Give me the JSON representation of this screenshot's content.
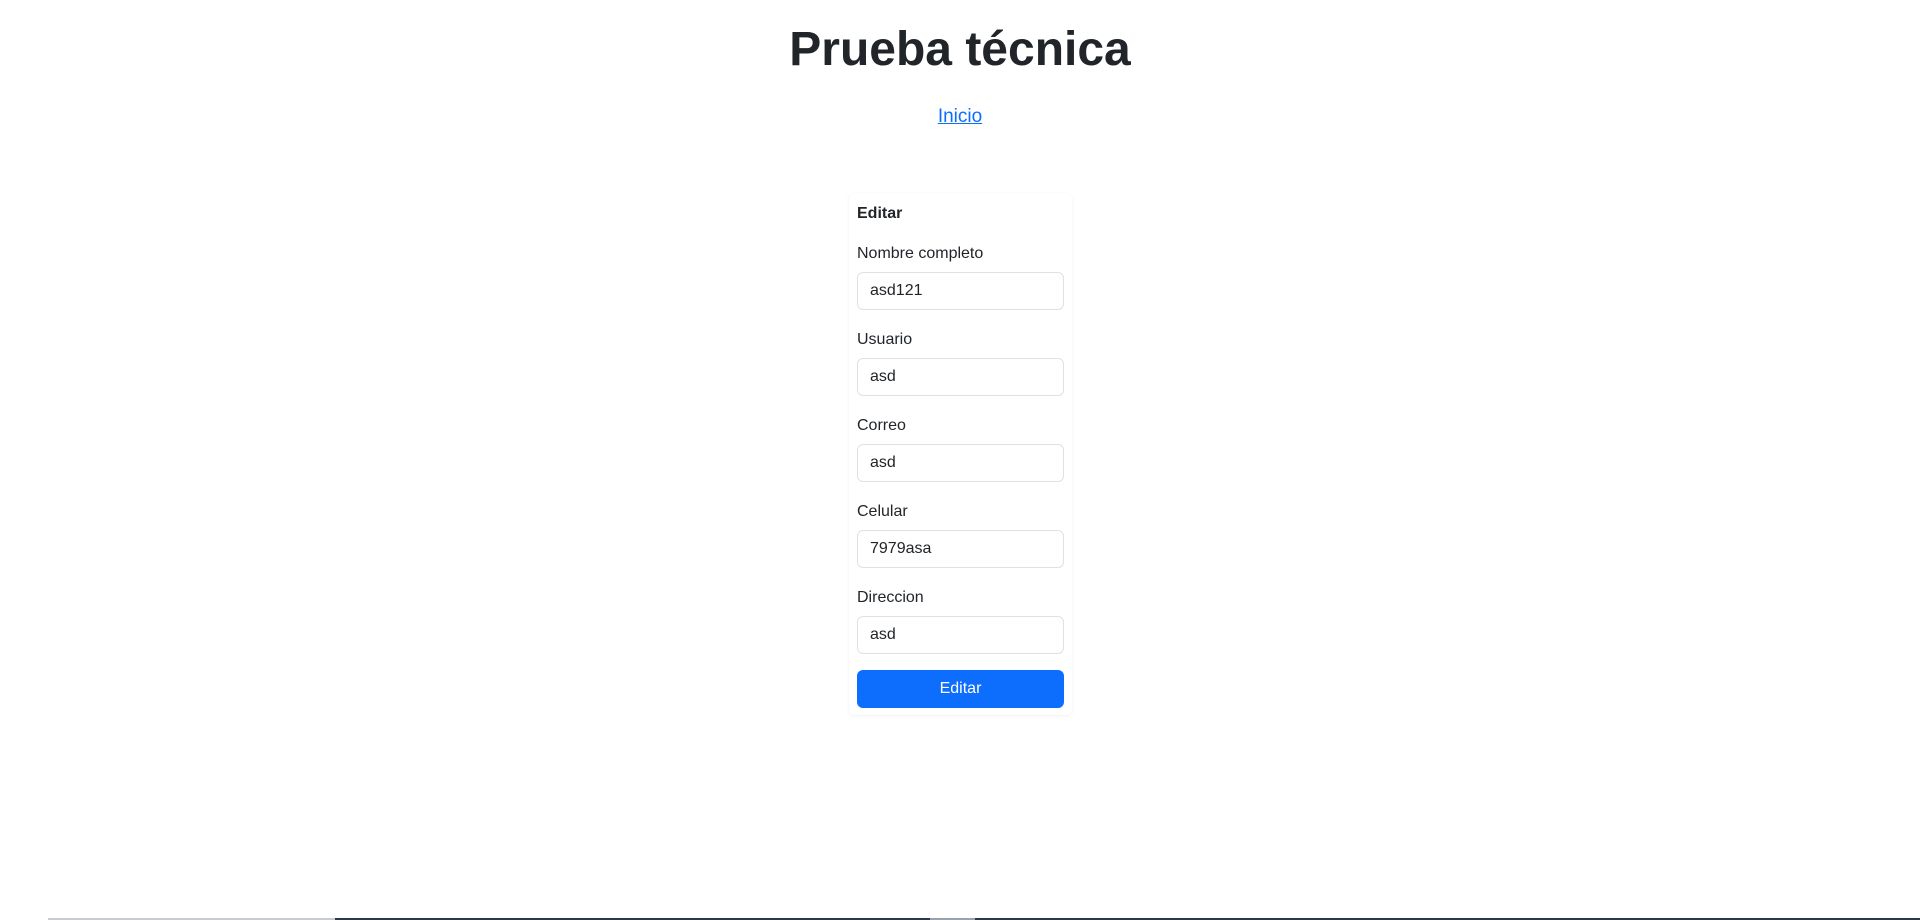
{
  "header": {
    "title": "Prueba técnica",
    "home_link": "Inicio"
  },
  "form": {
    "title": "Editar",
    "fields": [
      {
        "label": "Nombre completo",
        "value": "asd121"
      },
      {
        "label": "Usuario",
        "value": "asd"
      },
      {
        "label": "Correo",
        "value": "asd"
      },
      {
        "label": "Celular",
        "value": "7979asa"
      },
      {
        "label": "Direccion",
        "value": "asd"
      }
    ],
    "submit_label": "Editar"
  },
  "colors": {
    "primary": "#0d6efd",
    "link": "#0d6efd",
    "text": "#212529",
    "input_border": "#dee2e6"
  }
}
